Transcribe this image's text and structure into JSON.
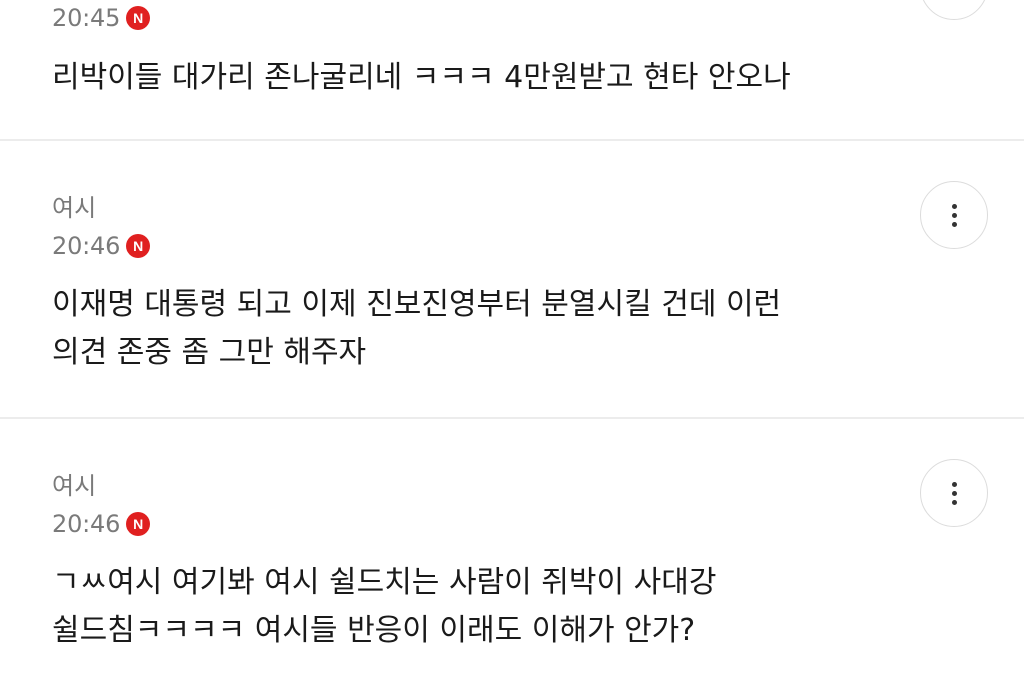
{
  "badge_label": "N",
  "comments": [
    {
      "author": "",
      "time": "20:45",
      "lines": [
        "리박이들 대가리 존나굴리네 ㅋㅋㅋ 4만원받고 현타 안오나"
      ]
    },
    {
      "author": "여시",
      "time": "20:46",
      "lines": [
        "이재명 대통령 되고 이제 진보진영부터 분열시킬 건데 이런",
        "의견 존중 좀 그만 해주자"
      ]
    },
    {
      "author": "여시",
      "time": "20:46",
      "lines": [
        "ㄱㅆ여시 여기봐 여시 쉴드치는 사람이 쥐박이 사대강",
        "쉴드침ㅋㅋㅋㅋ 여시들 반응이 이래도 이해가 안가?"
      ]
    }
  ],
  "colors": {
    "badge": "#e02020",
    "meta_text": "#7a7a7a",
    "body_text": "#1a1a1a",
    "divider": "#ececec"
  },
  "icons": {
    "more": "more-vertical-icon",
    "new": "new-badge-icon"
  }
}
